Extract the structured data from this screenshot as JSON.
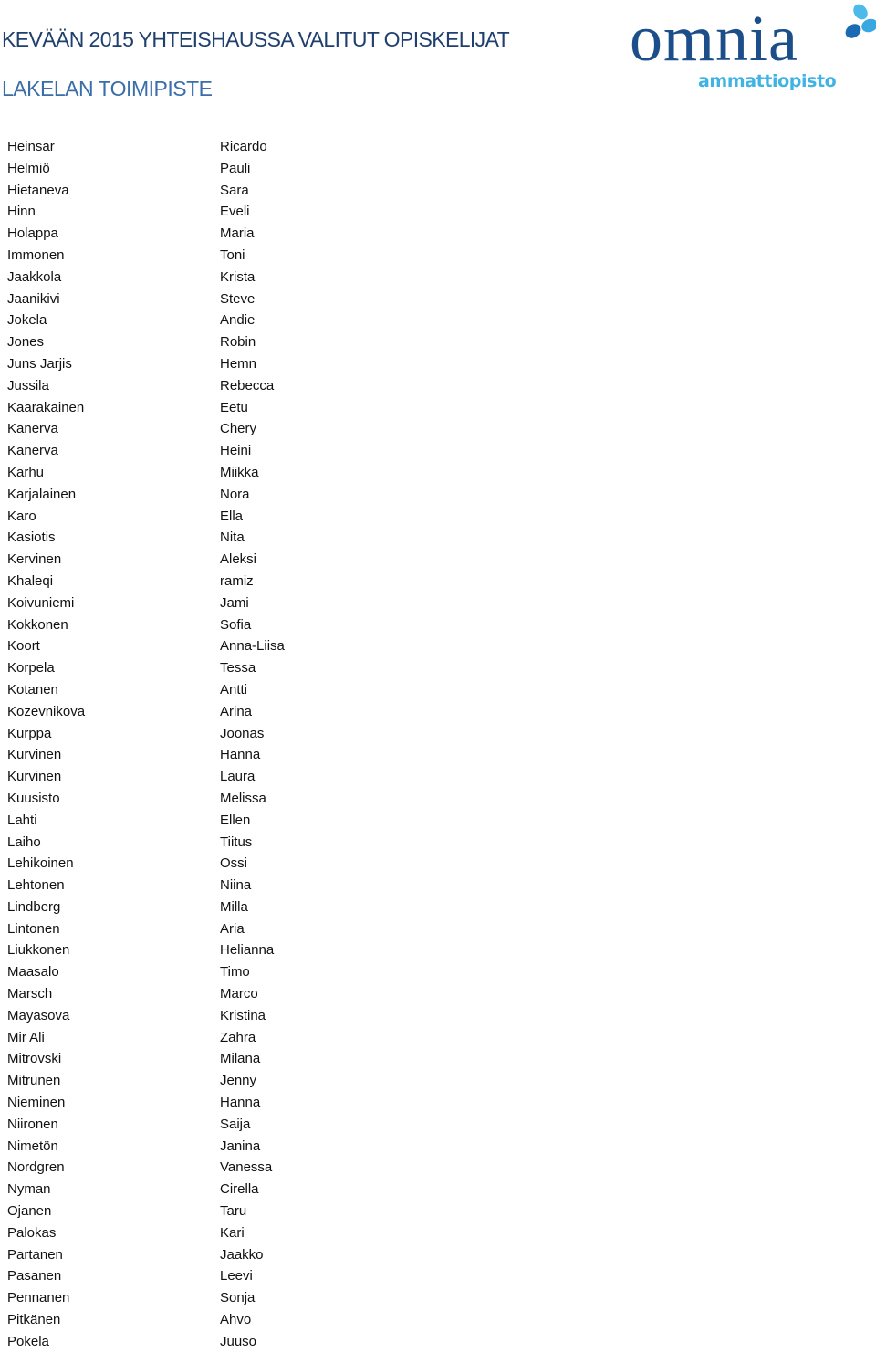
{
  "header": {
    "title": "KEVÄÄN 2015 YHTEISHAUSSA VALITUT OPISKELIJAT",
    "subtitle": "LAKELAN TOIMIPISTE"
  },
  "logo": {
    "wordmark": "omnia",
    "tagline": "ammattiopisto",
    "icon": "omnia-cross-mark-icon",
    "colors": {
      "wordmark": "#1c4f8a",
      "tagline": "#3fb3e4",
      "mark_light": "#4cbbe9",
      "mark_dark": "#1a6bb3"
    }
  },
  "students": [
    {
      "last": "Heinsar",
      "first": "Ricardo"
    },
    {
      "last": "Helmiö",
      "first": "Pauli"
    },
    {
      "last": "Hietaneva",
      "first": "Sara"
    },
    {
      "last": "Hinn",
      "first": "Eveli"
    },
    {
      "last": "Holappa",
      "first": "Maria"
    },
    {
      "last": "Immonen",
      "first": "Toni"
    },
    {
      "last": "Jaakkola",
      "first": "Krista"
    },
    {
      "last": "Jaanikivi",
      "first": "Steve"
    },
    {
      "last": "Jokela",
      "first": "Andie"
    },
    {
      "last": "Jones",
      "first": "Robin"
    },
    {
      "last": "Juns Jarjis",
      "first": "Hemn"
    },
    {
      "last": "Jussila",
      "first": "Rebecca"
    },
    {
      "last": "Kaarakainen",
      "first": "Eetu"
    },
    {
      "last": "Kanerva",
      "first": "Chery"
    },
    {
      "last": "Kanerva",
      "first": "Heini"
    },
    {
      "last": "Karhu",
      "first": "Miikka"
    },
    {
      "last": "Karjalainen",
      "first": "Nora"
    },
    {
      "last": "Karo",
      "first": "Ella"
    },
    {
      "last": "Kasiotis",
      "first": "Nita"
    },
    {
      "last": "Kervinen",
      "first": "Aleksi"
    },
    {
      "last": "Khaleqi",
      "first": "ramiz"
    },
    {
      "last": "Koivuniemi",
      "first": "Jami"
    },
    {
      "last": "Kokkonen",
      "first": "Sofia"
    },
    {
      "last": "Koort",
      "first": "Anna-Liisa"
    },
    {
      "last": "Korpela",
      "first": "Tessa"
    },
    {
      "last": "Kotanen",
      "first": "Antti"
    },
    {
      "last": "Kozevnikova",
      "first": "Arina"
    },
    {
      "last": "Kurppa",
      "first": "Joonas"
    },
    {
      "last": "Kurvinen",
      "first": "Hanna"
    },
    {
      "last": "Kurvinen",
      "first": "Laura"
    },
    {
      "last": "Kuusisto",
      "first": "Melissa"
    },
    {
      "last": "Lahti",
      "first": "Ellen"
    },
    {
      "last": "Laiho",
      "first": "Tiitus"
    },
    {
      "last": "Lehikoinen",
      "first": "Ossi"
    },
    {
      "last": "Lehtonen",
      "first": "Niina"
    },
    {
      "last": "Lindberg",
      "first": "Milla"
    },
    {
      "last": "Lintonen",
      "first": "Aria"
    },
    {
      "last": "Liukkonen",
      "first": "Helianna"
    },
    {
      "last": "Maasalo",
      "first": "Timo"
    },
    {
      "last": "Marsch",
      "first": "Marco"
    },
    {
      "last": "Mayasova",
      "first": "Kristina"
    },
    {
      "last": "Mir Ali",
      "first": "Zahra"
    },
    {
      "last": "Mitrovski",
      "first": "Milana"
    },
    {
      "last": "Mitrunen",
      "first": "Jenny"
    },
    {
      "last": "Nieminen",
      "first": "Hanna"
    },
    {
      "last": "Niironen",
      "first": "Saija"
    },
    {
      "last": "Nimetön",
      "first": "Janina"
    },
    {
      "last": "Nordgren",
      "first": "Vanessa"
    },
    {
      "last": "Nyman",
      "first": "Cirella"
    },
    {
      "last": "Ojanen",
      "first": "Taru"
    },
    {
      "last": "Palokas",
      "first": "Kari"
    },
    {
      "last": "Partanen",
      "first": "Jaakko"
    },
    {
      "last": "Pasanen",
      "first": "Leevi"
    },
    {
      "last": "Pennanen",
      "first": "Sonja"
    },
    {
      "last": "Pitkänen",
      "first": "Ahvo"
    },
    {
      "last": "Pokela",
      "first": "Juuso"
    }
  ]
}
